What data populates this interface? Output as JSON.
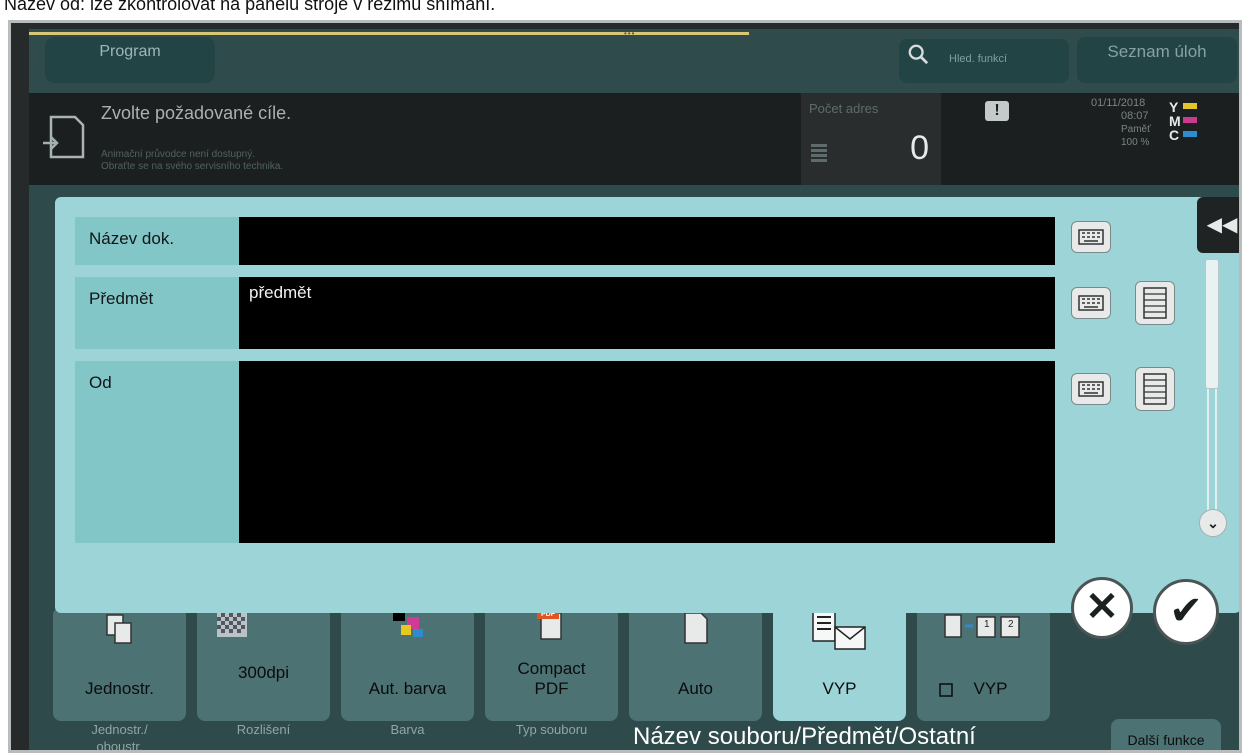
{
  "caption": "Název od: lze zkontrolovat na panelu stroje v režimu snímání.",
  "topbar": {
    "program_label": "Program",
    "search_label": "Hled. funkcí",
    "jobs_label": "Seznam úloh"
  },
  "message": {
    "main": "Zvolte požadované cíle.",
    "sub1": "Animační průvodce není dostupný.",
    "sub2": "Obraťte se na svého servisního technika.",
    "addr_label": "Počet adres",
    "addr_count": "0"
  },
  "status": {
    "date": "01/11/2018",
    "time": "08:07",
    "memory_label": "Paměť",
    "memory_pct": "100 %",
    "toner": [
      {
        "letter": "Y",
        "color": "#e2c42b"
      },
      {
        "letter": "M",
        "color": "#c93b8f"
      },
      {
        "letter": "C",
        "color": "#2d8bd0"
      }
    ]
  },
  "fields": [
    {
      "label": "Název dok.",
      "value": ""
    },
    {
      "label": "Předmět",
      "value": "předmět"
    },
    {
      "label": "Od",
      "value": ""
    }
  ],
  "tiles": [
    {
      "label": "Jednostr.",
      "caption1": "Jednostr./",
      "caption2": "oboustr.",
      "icon": "duplex-icon"
    },
    {
      "label": "300dpi",
      "caption1": "Rozlišení",
      "caption2": "",
      "icon": "resolution-icon"
    },
    {
      "label": "Aut. barva",
      "caption1": "Barva",
      "caption2": "",
      "icon": "color-icon"
    },
    {
      "label1": "Compact",
      "label2": "PDF",
      "caption1": "Typ souboru",
      "caption2": "",
      "icon": "pdf-icon",
      "icon_text": "PDF"
    },
    {
      "label": "Auto",
      "caption1": "",
      "caption2": "",
      "icon": "page-icon"
    },
    {
      "label": "VYP",
      "caption1": "",
      "caption2": "",
      "icon": "mail-doc-icon"
    },
    {
      "label": "VYP",
      "caption1": "",
      "caption2": "",
      "icon": "page-sequence-icon"
    }
  ],
  "tile_number_icons": [
    "1",
    "2"
  ],
  "big_caption": "Název souboru/Předmět/Ostatní",
  "more_label": "Další funkce"
}
